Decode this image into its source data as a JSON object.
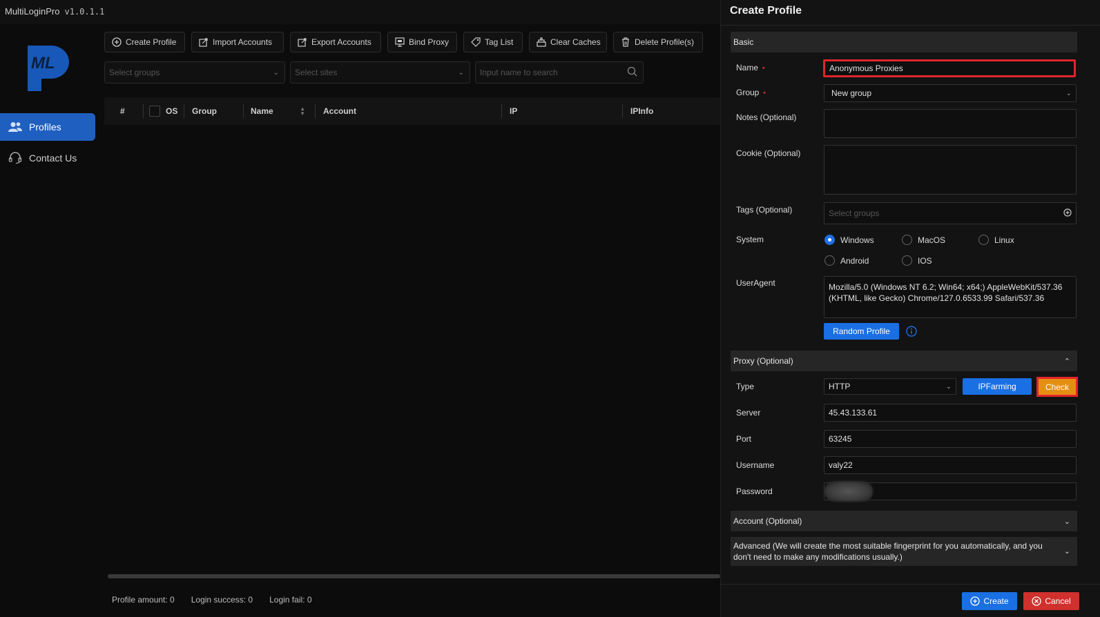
{
  "app": {
    "title": "MultiLoginPro",
    "version": "v1.0.1.1"
  },
  "logo": {
    "text": "ML"
  },
  "nav": [
    {
      "label": "Profiles",
      "icon": "users-icon",
      "active": true
    },
    {
      "label": "Contact Us",
      "icon": "headset-icon",
      "active": false
    }
  ],
  "toolbar": [
    {
      "label": "Create Profile",
      "icon": "plus-circle-icon"
    },
    {
      "label": "Import Accounts",
      "icon": "import-icon"
    },
    {
      "label": "Export Accounts",
      "icon": "export-icon"
    },
    {
      "label": "Bind Proxy",
      "icon": "bind-proxy-icon"
    },
    {
      "label": "Tag List",
      "icon": "tag-icon"
    },
    {
      "label": "Clear Caches",
      "icon": "clear-icon"
    },
    {
      "label": "Delete Profile(s)",
      "icon": "trash-icon"
    }
  ],
  "filters": {
    "groups_placeholder": "Select groups",
    "sites_placeholder": "Select sites",
    "search_placeholder": "Input name to search"
  },
  "table": {
    "columns": [
      "#",
      "OS",
      "Group",
      "Name",
      "Account",
      "IP",
      "IPInfo"
    ]
  },
  "footer": {
    "profile_amount": "Profile amount: 0",
    "login_success": "Login success: 0",
    "login_fail": "Login fail: 0"
  },
  "panel": {
    "title": "Create Profile",
    "basic": {
      "section_label": "Basic",
      "name_label": "Name",
      "name_value": "Anonymous Proxies",
      "group_label": "Group",
      "group_value": "New group",
      "notes_label": "Notes (Optional)",
      "cookie_label": "Cookie (Optional)",
      "tags_label": "Tags (Optional)",
      "tags_placeholder": "Select groups",
      "system_label": "System",
      "systems": [
        "Windows",
        "MacOS",
        "Linux",
        "Android",
        "IOS"
      ],
      "system_selected": "Windows",
      "useragent_label": "UserAgent",
      "useragent_value": "Mozilla/5.0 (Windows NT 6.2; Win64; x64;) AppleWebKit/537.36 (KHTML, like Gecko) Chrome/127.0.6533.99 Safari/537.36",
      "random_profile_label": "Random Profile"
    },
    "proxy": {
      "section_label": "Proxy (Optional)",
      "type_label": "Type",
      "type_value": "HTTP",
      "ipfarming_label": "IPFarming",
      "check_label": "Check",
      "server_label": "Server",
      "server_value": "45.43.133.61",
      "port_label": "Port",
      "port_value": "63245",
      "username_label": "Username",
      "username_value": "valy22",
      "password_label": "Password"
    },
    "account": {
      "section_label": "Account (Optional)"
    },
    "advanced": {
      "section_label": "Advanced (We will create the most suitable fingerprint for you automatically, and you don't need to make any modifications usually.)"
    },
    "create_label": "Create",
    "cancel_label": "Cancel"
  },
  "colors": {
    "accent": "#1a6fe3",
    "danger": "#d0312d",
    "highlight": "#e0252b",
    "check_bg": "#e58f12"
  }
}
